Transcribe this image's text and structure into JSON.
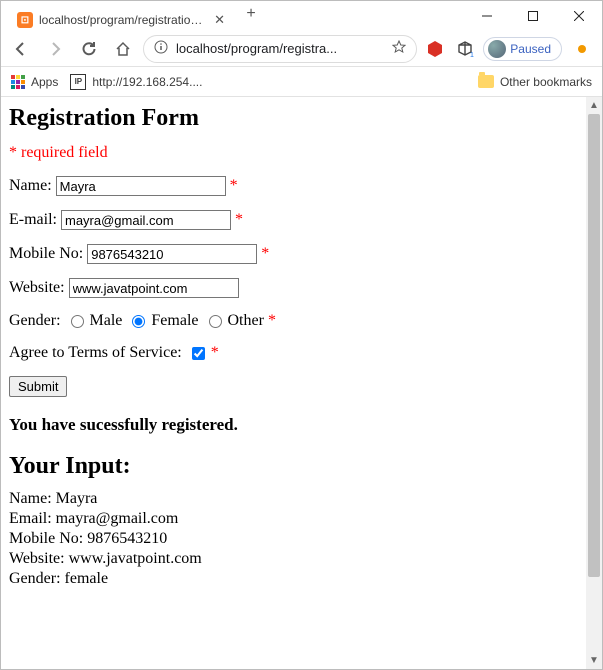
{
  "window": {
    "tab_title": "localhost/program/registration.p",
    "url_display": "localhost/program/registra...",
    "paused_label": "Paused",
    "bookmarks": {
      "apps_label": "Apps",
      "ip_label": "http://192.168.254....",
      "other_label": "Other bookmarks"
    }
  },
  "form": {
    "heading": "Registration Form",
    "required_note": "* required field",
    "name_label": "Name:",
    "name_value": "Mayra",
    "email_label": "E-mail:",
    "email_value": "mayra@gmail.com",
    "mobile_label": "Mobile No:",
    "mobile_value": "9876543210",
    "website_label": "Website:",
    "website_value": "www.javatpoint.com",
    "gender_label": "Gender:",
    "gender_options": {
      "male": "Male",
      "female": "Female",
      "other": "Other"
    },
    "gender_selected": "female",
    "agree_label": "Agree to Terms of Service:",
    "agree_checked": true,
    "submit_label": "Submit",
    "asterisk": "*"
  },
  "result": {
    "success": "You have sucessfully registered.",
    "heading": "Your Input:",
    "lines": {
      "name": "Name: Mayra",
      "email": "Email: mayra@gmail.com",
      "mobile": "Mobile No: 9876543210",
      "website": "Website: www.javatpoint.com",
      "gender": "Gender: female"
    }
  }
}
